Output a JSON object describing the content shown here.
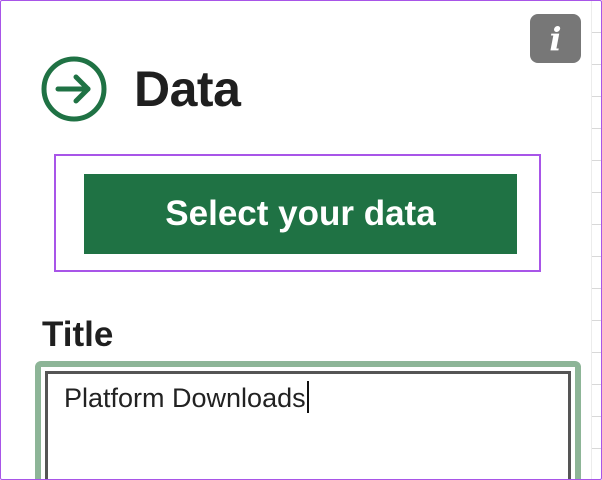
{
  "info_button": {
    "label": "i",
    "icon": "info-icon"
  },
  "section": {
    "title": "Data",
    "icon": "arrow-right-circle-icon"
  },
  "select_data": {
    "label": "Select your data"
  },
  "title_field": {
    "label": "Title",
    "value": "Platform Downloads"
  },
  "colors": {
    "accent_green": "#1f7244",
    "focus_outline": "#8db597",
    "selection_outline": "#a855e8",
    "info_gray": "#777777"
  }
}
